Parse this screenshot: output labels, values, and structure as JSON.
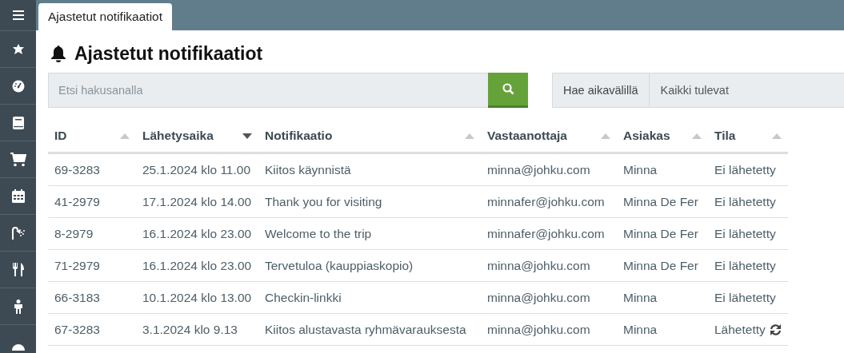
{
  "tab": {
    "label": "Ajastetut notifikaatiot",
    "selected": true
  },
  "title": "Ajastetut notifikaatiot",
  "search": {
    "placeholder": "Etsi hakusanalla"
  },
  "range": {
    "label": "Hae aikavälillä",
    "value": "Kaikki tulevat"
  },
  "table": {
    "columns": [
      {
        "label": "ID",
        "sorted": false
      },
      {
        "label": "Lähetysaika",
        "sorted": true
      },
      {
        "label": "Notifikaatio",
        "sorted": false
      },
      {
        "label": "Vastaanottaja",
        "sorted": false
      },
      {
        "label": "Asiakas",
        "sorted": false
      },
      {
        "label": "Tila",
        "sorted": false
      }
    ],
    "rows": [
      {
        "cells": [
          "69-3283",
          "25.1.2024 klo 11.00",
          "Kiitos käynnistä",
          "minna@johku.com",
          "Minna",
          "Ei lähetetty"
        ],
        "resend": false
      },
      {
        "cells": [
          "41-2979",
          "17.1.2024 klo 14.00",
          "Thank you for visiting",
          "minnafer@johku.com",
          "Minna De Fer",
          "Ei lähetetty"
        ],
        "resend": false
      },
      {
        "cells": [
          "8-2979",
          "16.1.2024 klo 23.00",
          "Welcome to the trip",
          "minnafer@johku.com",
          "Minna De Fer",
          "Ei lähetetty"
        ],
        "resend": false
      },
      {
        "cells": [
          "71-2979",
          "16.1.2024 klo 23.00",
          "Tervetuloa (kauppiaskopio)",
          "minna@johku.com",
          "Minna De Fer",
          "Ei lähetetty"
        ],
        "resend": false
      },
      {
        "cells": [
          "66-3183",
          "10.1.2024 klo 13.00",
          "Checkin-linkki",
          "minna@johku.com",
          "Minna",
          "Ei lähetetty"
        ],
        "resend": false
      },
      {
        "cells": [
          "67-3283",
          "3.1.2024 klo 9.13",
          "Kiitos alustavasta ryhmävarauksesta",
          "minna@johku.com",
          "Minna",
          "Lähetetty"
        ],
        "resend": true
      }
    ]
  }
}
